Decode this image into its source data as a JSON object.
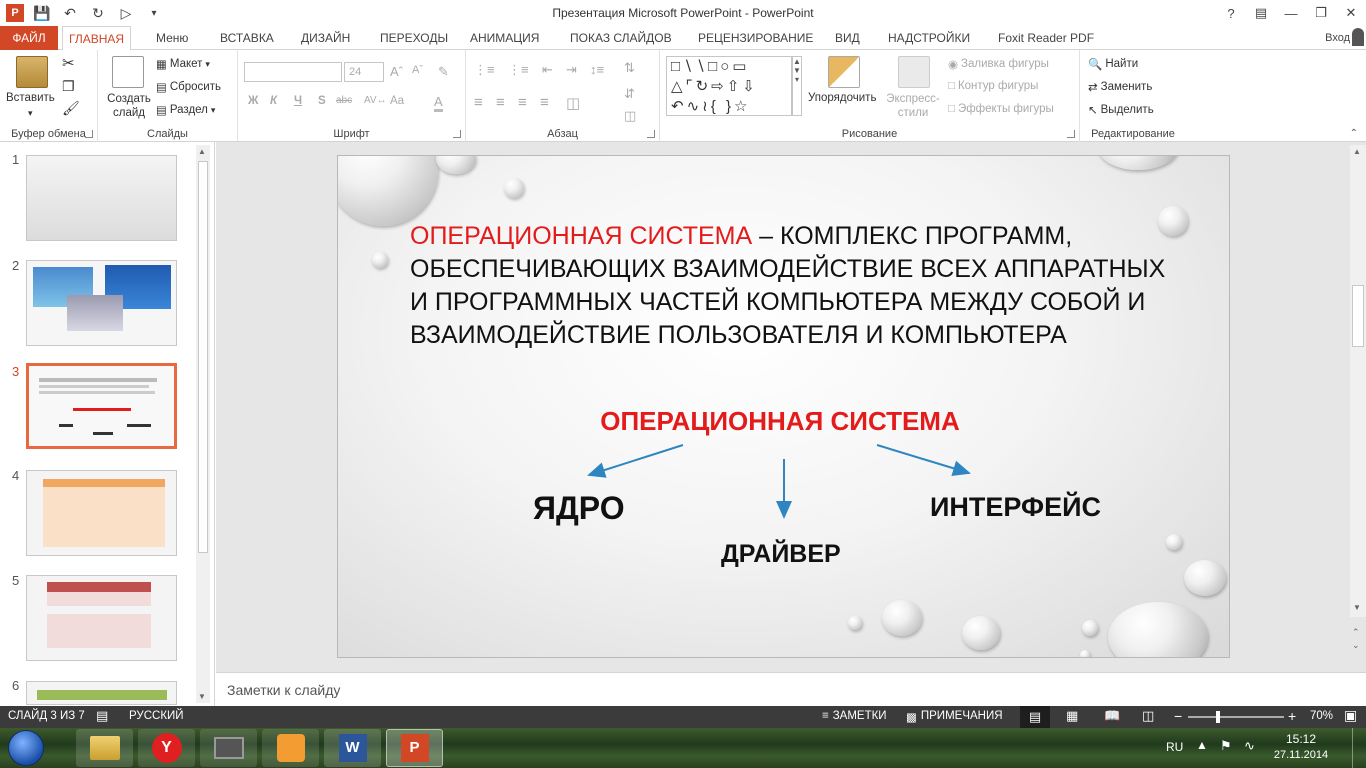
{
  "window": {
    "title": "Презентация Microsoft PowerPoint - PowerPoint",
    "help": "?",
    "sign_in": "Вход"
  },
  "tabs": [
    "ФАЙЛ",
    "ГЛАВНАЯ",
    "Меню",
    "ВСТАВКА",
    "ДИЗАЙН",
    "ПЕРЕХОДЫ",
    "АНИМАЦИЯ",
    "ПОКАЗ СЛАЙДОВ",
    "РЕЦЕНЗИРОВАНИЕ",
    "ВИД",
    "НАДСТРОЙКИ",
    "Foxit Reader PDF"
  ],
  "ribbon": {
    "clipboard": {
      "label": "Буфер обмена",
      "paste": "Вставить"
    },
    "slides": {
      "label": "Слайды",
      "new_slide": "Создать слайд",
      "layout": "Макет",
      "reset": "Сбросить",
      "section": "Раздел"
    },
    "font": {
      "label": "Шрифт",
      "size": "24",
      "bold": "Ж",
      "italic": "К",
      "underline": "Ч",
      "strike": "S",
      "case": "Aa"
    },
    "paragraph": {
      "label": "Абзац"
    },
    "drawing": {
      "label": "Рисование",
      "arrange": "Упорядочить",
      "quick_styles": "Экспресс-стили",
      "fill": "Заливка фигуры",
      "outline": "Контур фигуры",
      "effects": "Эффекты фигуры"
    },
    "editing": {
      "label": "Редактирование",
      "find": "Найти",
      "replace": "Заменить",
      "select": "Выделить"
    }
  },
  "thumbnails": [
    {
      "num": "1"
    },
    {
      "num": "2"
    },
    {
      "num": "3"
    },
    {
      "num": "4"
    },
    {
      "num": "5"
    },
    {
      "num": "6"
    }
  ],
  "slide": {
    "definition_term": "ОПЕРАЦИОННАЯ СИСТЕМА",
    "definition_rest": " – КОМПЛЕКС ПРОГРАММ, ОБЕСПЕЧИВАЮЩИХ ВЗАИМОДЕЙСТВИЕ ВСЕХ АППАРАТНЫХ И ПРОГРАММНЫХ ЧАСТЕЙ КОМПЬЮТЕРА МЕЖДУ СОБОЙ И ВЗАИМОДЕЙСТВИЕ ПОЛЬЗОВАТЕЛЯ И КОМПЬЮТЕРА",
    "diagram_title": "ОПЕРАЦИОННАЯ СИСТЕМА",
    "node_left": "ЯДРО",
    "node_middle": "ДРАЙВЕР",
    "node_right": "ИНТЕРФЕЙС"
  },
  "notes_placeholder": "Заметки к слайду",
  "status": {
    "slide_counter": "СЛАЙД 3 ИЗ 7",
    "language": "РУССКИЙ",
    "notes": "ЗАМЕТКИ",
    "comments": "ПРИМЕЧАНИЯ",
    "zoom": "70%"
  },
  "taskbar": {
    "lang": "RU",
    "time": "15:12",
    "date": "27.11.2014"
  },
  "colors": {
    "accent": "#d24726",
    "title_red": "#e31b1b",
    "arrow": "#2e86c1"
  }
}
